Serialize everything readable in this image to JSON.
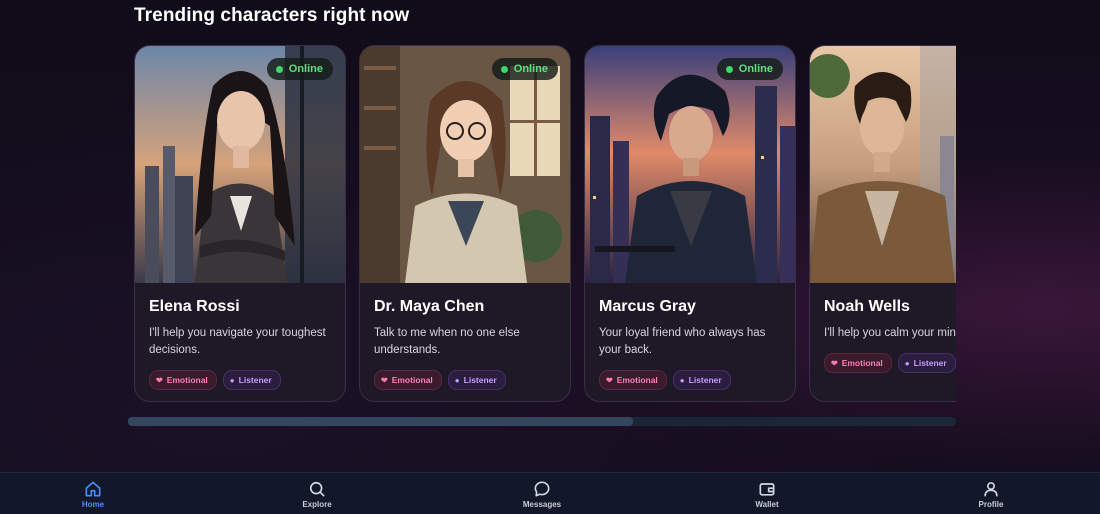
{
  "section": {
    "title": "Trending characters right now"
  },
  "characters": [
    {
      "name": "Elena Rossi",
      "status": "Online",
      "description": "I'll help you navigate your toughest decisions.",
      "tags": [
        "Emotional",
        "Listener"
      ]
    },
    {
      "name": "Dr. Maya Chen",
      "status": "Online",
      "description": "Talk to me when no one else understands.",
      "tags": [
        "Emotional",
        "Listener"
      ]
    },
    {
      "name": "Marcus Gray",
      "status": "Online",
      "description": "Your loyal friend who always has your back.",
      "tags": [
        "Emotional",
        "Listener"
      ]
    },
    {
      "name": "Noah Wells",
      "status": "",
      "description": "I'll help you calm your mind",
      "tags": [
        "Emotional",
        "Listener"
      ]
    }
  ],
  "carousel": {
    "scroll_fraction": 0.61
  },
  "nav": {
    "items": [
      {
        "label": "Home",
        "icon": "home-icon",
        "active": true
      },
      {
        "label": "Explore",
        "icon": "search-icon",
        "active": false
      },
      {
        "label": "Messages",
        "icon": "chat-bubble-icon",
        "active": false
      },
      {
        "label": "Wallet",
        "icon": "wallet-icon",
        "active": false
      },
      {
        "label": "Profile",
        "icon": "user-icon",
        "active": false
      }
    ]
  },
  "colors": {
    "accent": "#4d8dff",
    "online": "#3fd66a",
    "emotional_tag": "#ff7db5",
    "listener_tag": "#c69cff"
  }
}
